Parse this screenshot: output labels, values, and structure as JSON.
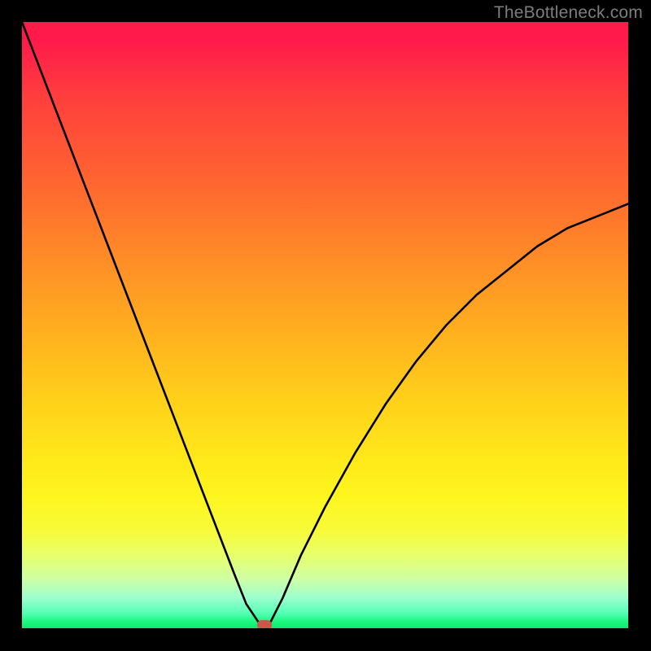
{
  "watermark": "TheBottleneck.com",
  "chart_data": {
    "type": "line",
    "title": "",
    "xlabel": "",
    "ylabel": "",
    "xlim": [
      0,
      100
    ],
    "ylim": [
      0,
      100
    ],
    "grid": false,
    "series": [
      {
        "name": "bottleneck-curve",
        "x": [
          0,
          5,
          10,
          15,
          20,
          25,
          30,
          35,
          37,
          39,
          40,
          41,
          43,
          46,
          50,
          55,
          60,
          65,
          70,
          75,
          80,
          85,
          90,
          95,
          100
        ],
        "y": [
          100,
          87,
          74,
          61,
          48,
          35,
          22,
          9,
          4,
          1,
          0,
          1,
          5,
          12,
          20,
          29,
          37,
          44,
          50,
          55,
          59,
          63,
          66,
          68,
          70
        ]
      }
    ],
    "marker": {
      "x": 40,
      "y": 0.6
    },
    "background_gradient": {
      "stops": [
        {
          "pos": 0,
          "color": "#ff1a4b"
        },
        {
          "pos": 12,
          "color": "#ff3d3d"
        },
        {
          "pos": 28,
          "color": "#ff6a2f"
        },
        {
          "pos": 40,
          "color": "#ff8f26"
        },
        {
          "pos": 52,
          "color": "#ffb21e"
        },
        {
          "pos": 63,
          "color": "#ffd21a"
        },
        {
          "pos": 72,
          "color": "#ffe81a"
        },
        {
          "pos": 78,
          "color": "#fef51d"
        },
        {
          "pos": 88,
          "color": "#e8ff6d"
        },
        {
          "pos": 95,
          "color": "#9cffcf"
        },
        {
          "pos": 100,
          "color": "#12e673"
        }
      ]
    }
  }
}
